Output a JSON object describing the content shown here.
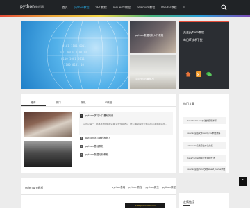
{
  "header": {
    "logo": "python",
    "logo_suffix": "教程网",
    "nav": [
      "首页",
      "python教程",
      "SEO教程",
      "requests教程",
      "selenium教程",
      "Pandas教程",
      "IT"
    ],
    "active_index": 1,
    "accent_color": "#27a9e1"
  },
  "hero": {
    "thumb1_title": "python数据分析入门教程",
    "thumb2_title": "学python编程入门"
  },
  "profile": {
    "line1": "关注python教程",
    "line2": "每日IT技术干货"
  },
  "tabs": [
    "推荐",
    "热门",
    "随机",
    "IT教程"
  ],
  "featured": {
    "num": "1",
    "title": "python学习入门基础知识",
    "desc": "python是一门简单易学的编程语言,适合零基础入门学习,本站提供大量python教程和案例..."
  },
  "list": [
    {
      "num": "2",
      "label": "python学习路线推荐?"
    },
    {
      "num": "3",
      "label": "python基础教程"
    },
    {
      "num": "4",
      "label": "python数据分析教程"
    }
  ],
  "hot": {
    "title": "热门文章",
    "items": [
      "DataFrame.loc方法的使用详解",
      "pandas读取文件read_csv参数详解",
      "selenium元素定位方法总结",
      "DataFrame删除行或列的方法",
      "pandas读取Excel文件sheet_name参数"
    ]
  },
  "section": {
    "title": "selenium教程",
    "links": [
      "python基础",
      "python教程",
      "python爬虫",
      "python教程"
    ],
    "thumb_text": "www.python66.com"
  },
  "links_card": {
    "title": "友情链接"
  },
  "back_top": "^"
}
